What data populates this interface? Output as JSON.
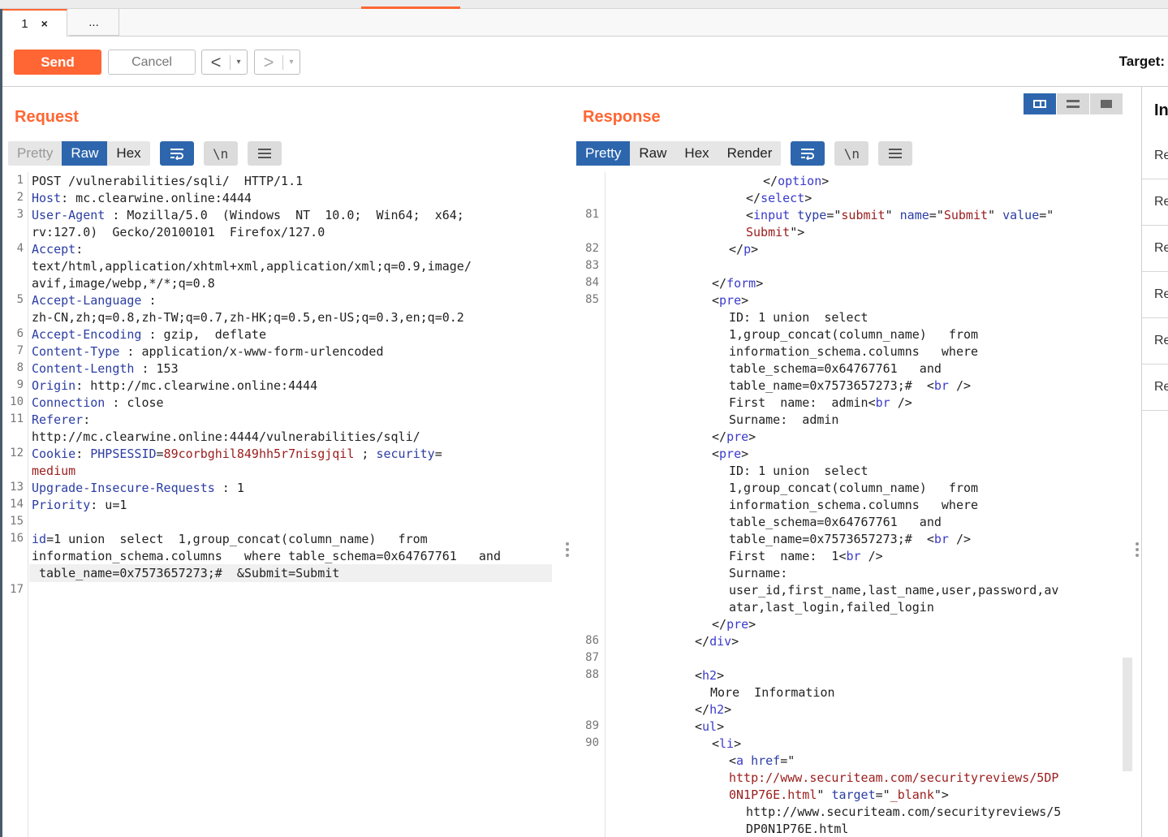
{
  "tabs": [
    {
      "label": "1",
      "close": "×"
    },
    {
      "label": "..."
    }
  ],
  "toolbar": {
    "send_label": "Send",
    "cancel_label": "Cancel",
    "back_arrow": "<",
    "forward_arrow": ">",
    "dropdown": "▾",
    "target_label": "Target:"
  },
  "request": {
    "title": "Request",
    "views": [
      "Pretty",
      "Raw",
      "Hex"
    ],
    "active_view": "Raw",
    "icons": [
      "wrap-icon",
      "newline-icon",
      "menu-icon"
    ],
    "icon_glyphs": {
      "newline": "\\n",
      "menu": "≡"
    }
  },
  "response": {
    "title": "Response",
    "views": [
      "Pretty",
      "Raw",
      "Hex",
      "Render"
    ],
    "active_view": "Pretty",
    "icon_glyphs": {
      "newline": "\\n",
      "menu": "≡"
    }
  },
  "inspector": {
    "title": "In",
    "items": [
      "Re",
      "Re",
      "Re",
      "Re",
      "Re",
      "Re"
    ]
  },
  "colors": {
    "accent": "#ff6633",
    "active_blue": "#2d66ad"
  }
}
